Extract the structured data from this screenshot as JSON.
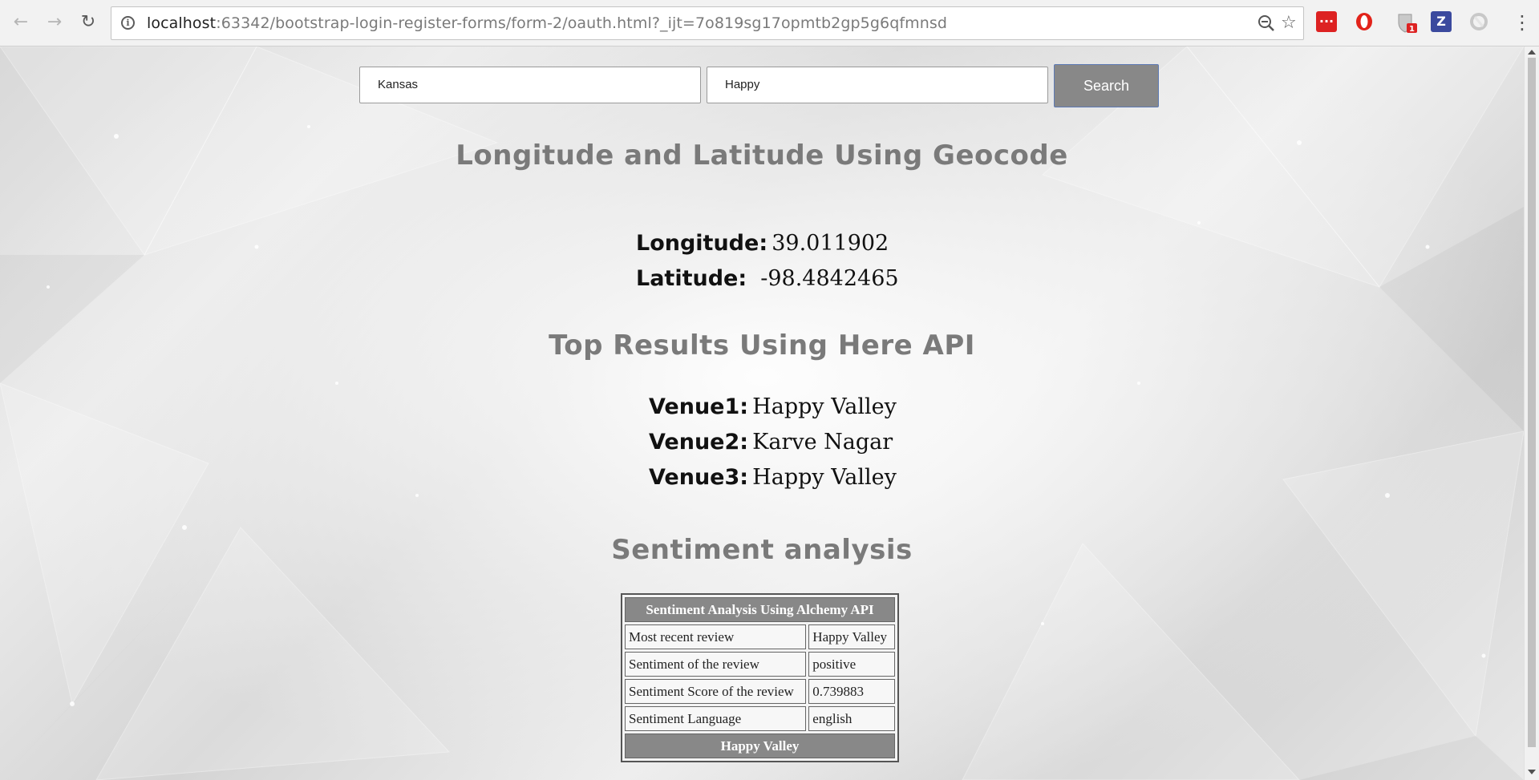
{
  "browser": {
    "url_host": "localhost",
    "url_rest": ":63342/bootstrap-login-register-forms/form-2/oauth.html?_ijt=7o819sg17opmtb2gp5g6qfmnsd",
    "extension_badge": "1"
  },
  "search": {
    "location_value": "Kansas",
    "query_value": "Happy",
    "button_label": "Search"
  },
  "geocode": {
    "heading": "Longitude and Latitude Using Geocode",
    "longitude_label": "Longitude:",
    "longitude_value": "39.011902",
    "latitude_label": "Latitude:",
    "latitude_value": "-98.4842465"
  },
  "results": {
    "heading": "Top Results Using Here API",
    "venues": [
      {
        "label": "Venue1:",
        "value": "Happy Valley"
      },
      {
        "label": "Venue2:",
        "value": "Karve Nagar"
      },
      {
        "label": "Venue3:",
        "value": "Happy Valley"
      }
    ]
  },
  "sentiment": {
    "heading": "Sentiment analysis",
    "table_title": "Sentiment Analysis Using Alchemy API",
    "rows": [
      {
        "label": "Most recent review",
        "value": "Happy Valley"
      },
      {
        "label": "Sentiment of the review",
        "value": "positive"
      },
      {
        "label": "Sentiment Score of the review",
        "value": "0.739883"
      },
      {
        "label": "Sentiment Language",
        "value": "english"
      }
    ],
    "footer": "Happy Valley"
  },
  "colors": {
    "heading": "#7a7a7a",
    "button": "#888888",
    "table_header": "#888888"
  }
}
